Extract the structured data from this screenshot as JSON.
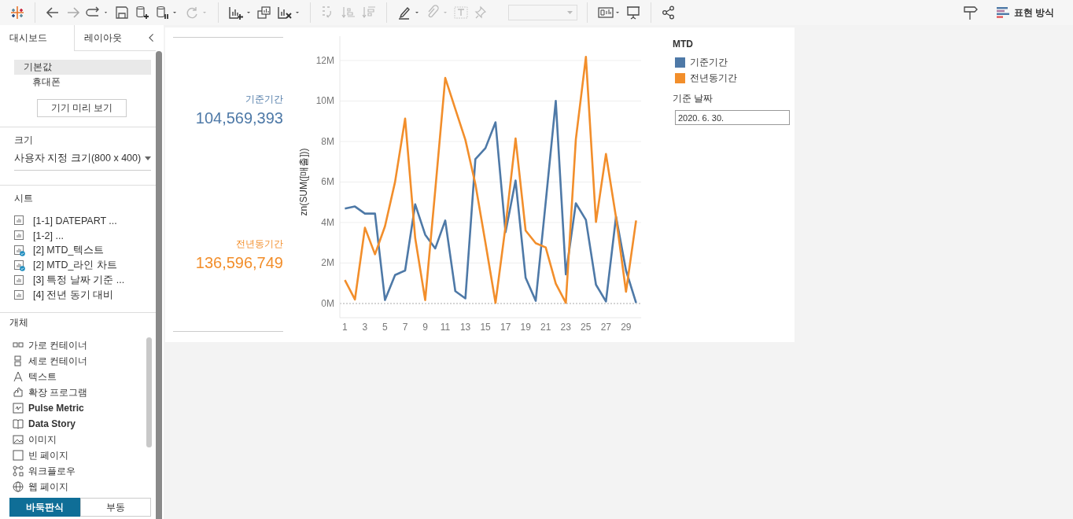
{
  "toolbar": {
    "presentation_button": "표현 방식"
  },
  "sidebar": {
    "tabs": [
      {
        "label": "대시보드",
        "selected": true
      },
      {
        "label": "레이아웃",
        "selected": false
      }
    ],
    "devices": [
      {
        "label": "기본값",
        "selected": true
      },
      {
        "label": "휴대폰",
        "selected": false
      }
    ],
    "preview_button": "기기 미리 보기",
    "size": {
      "title": "크기",
      "value": "사용자 지정 크기(800 x 400)"
    },
    "sheets": {
      "title": "시트",
      "items": [
        {
          "label": "[1-1] DATEPART ...",
          "used": false
        },
        {
          "label": "[1-2] ...",
          "used": false
        },
        {
          "label": "[2] MTD_텍스트",
          "used": true
        },
        {
          "label": "[2] MTD_라인 차트",
          "used": true
        },
        {
          "label": "[3] 특정 날짜 기준 ...",
          "used": false
        },
        {
          "label": "[4] 전년 동기 대비",
          "used": false
        }
      ]
    },
    "objects": {
      "title": "개체",
      "items": [
        {
          "label": "가로 컨테이너",
          "kind": "horizontal"
        },
        {
          "label": "세로 컨테이너",
          "kind": "vertical"
        },
        {
          "label": "텍스트",
          "kind": "text"
        },
        {
          "label": "확장 프로그램",
          "kind": "extension"
        },
        {
          "label": "Pulse Metric",
          "kind": "pulse"
        },
        {
          "label": "Data Story",
          "kind": "story"
        },
        {
          "label": "이미지",
          "kind": "image"
        },
        {
          "label": "빈 페이지",
          "kind": "blank"
        },
        {
          "label": "워크플로우",
          "kind": "workflow"
        },
        {
          "label": "웹 페이지",
          "kind": "web"
        }
      ]
    },
    "layout_mode": [
      {
        "label": "바둑판식",
        "selected": true
      },
      {
        "label": "부동",
        "selected": false
      }
    ]
  },
  "dashboard": {
    "kpis": [
      {
        "label": "기준기간",
        "value": "104,569,393",
        "color": "#4e79a7"
      },
      {
        "label": "전년동기간",
        "value": "136,596,749",
        "color": "#f28e2b"
      }
    ],
    "chart_data": {
      "type": "line",
      "ylabel": "zn(SUM([매출]))",
      "x": [
        1,
        2,
        3,
        4,
        5,
        6,
        7,
        8,
        9,
        10,
        11,
        12,
        13,
        14,
        15,
        16,
        17,
        18,
        19,
        20,
        21,
        22,
        23,
        24,
        25,
        26,
        27,
        28,
        29,
        30
      ],
      "series": [
        {
          "name": "기준기간",
          "color": "#4e79a7",
          "values": [
            4.69,
            4.79,
            4.44,
            4.44,
            0.17,
            1.41,
            1.63,
            4.9,
            3.4,
            2.72,
            4.1,
            0.61,
            0.25,
            7.13,
            7.67,
            8.95,
            3.52,
            6.07,
            1.27,
            0.13,
            5.0,
            10.0,
            1.44,
            4.95,
            4.13,
            0.93,
            0.1,
            4.29,
            1.63,
            0.03
          ]
        },
        {
          "name": "전년동기간",
          "color": "#f28e2b",
          "values": [
            1.16,
            0.2,
            3.74,
            2.43,
            3.81,
            6.0,
            9.13,
            3.23,
            0.17,
            5.6,
            11.14,
            9.6,
            8.08,
            5.9,
            3.0,
            0.03,
            3.8,
            8.15,
            3.6,
            2.98,
            2.77,
            0.98,
            0.03,
            8.1,
            12.18,
            4.03,
            7.38,
            4.25,
            0.58,
            4.1
          ]
        }
      ],
      "grid": true,
      "ref_lines": [
        {
          "axis": "y",
          "value": 0
        }
      ],
      "xlim": [
        0.5,
        30.5
      ],
      "ylim": [
        -0.7,
        13.2
      ],
      "xticks": [
        1,
        3,
        5,
        7,
        9,
        11,
        13,
        15,
        17,
        19,
        21,
        23,
        25,
        27,
        29
      ],
      "yticks": [
        {
          "value": 0,
          "label": "0M"
        },
        {
          "value": 2,
          "label": "2M"
        },
        {
          "value": 4,
          "label": "4M"
        },
        {
          "value": 6,
          "label": "6M"
        },
        {
          "value": 8,
          "label": "8M"
        },
        {
          "value": 10,
          "label": "10M"
        },
        {
          "value": 12,
          "label": "12M"
        }
      ]
    },
    "legend": {
      "title": "MTD"
    },
    "filter": {
      "title": "기준 날짜",
      "value": "2020. 6. 30."
    }
  }
}
